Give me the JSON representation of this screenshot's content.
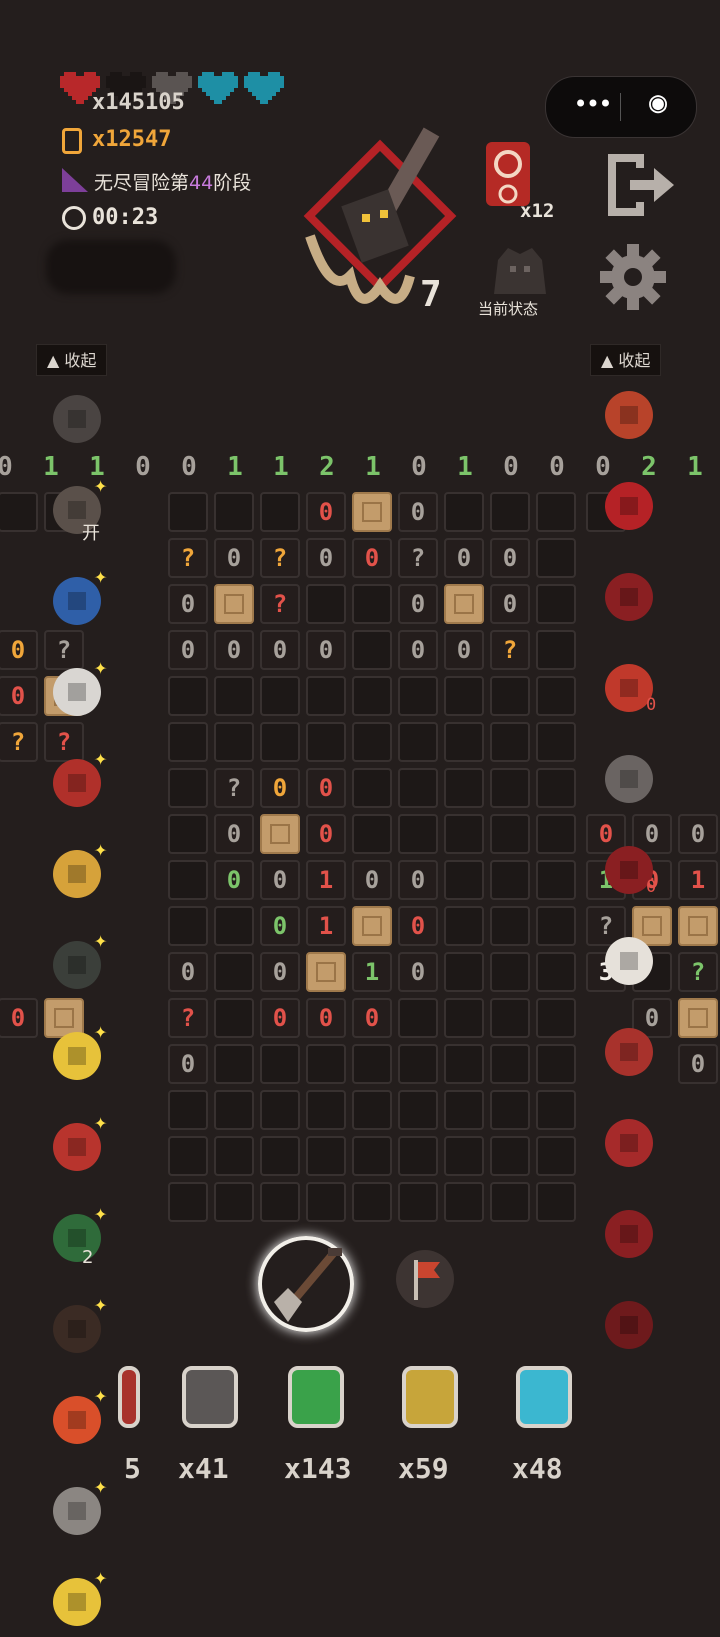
{
  "hud": {
    "hp_value": "x145105",
    "coin_value": "x12547",
    "stage_prefix": "无尽冒险第",
    "stage_number": "44",
    "stage_suffix": "阶段",
    "timer": "00:23"
  },
  "menu_capsule": {
    "more_glyph": "•••",
    "close_glyph": "◉"
  },
  "boss": {
    "level": "7"
  },
  "status": {
    "scroll_count": "x12",
    "current_status_label": "当前状态"
  },
  "panels": {
    "left_collapse": "▲ 收起",
    "right_collapse": "▲ 收起"
  },
  "column_hints": [
    "0",
    "1",
    "1",
    "0",
    "0",
    "1",
    "1",
    "2",
    "1",
    "0",
    "1",
    "0",
    "0",
    "0",
    "2",
    "1"
  ],
  "column_hint_colors": [
    "#a7a19b",
    "#7cc46a",
    "#7cc46a",
    "#a7a19b",
    "#a7a19b",
    "#7cc46a",
    "#7cc46a",
    "#7cc46a",
    "#7cc46a",
    "#a7a19b",
    "#7cc46a",
    "#a7a19b",
    "#a7a19b",
    "#a7a19b",
    "#7cc46a",
    "#7cc46a"
  ],
  "left_items": [
    {
      "icon": "dark-rock-icon"
    },
    {
      "icon": "pickaxe-icon",
      "sub": "开"
    },
    {
      "icon": "blue-chain-icon"
    },
    {
      "icon": "white-stone-icon"
    },
    {
      "icon": "red-explosion-icon"
    },
    {
      "icon": "gold-shield-icon"
    },
    {
      "icon": "hooded-figure-icon"
    },
    {
      "icon": "golden-idol-icon"
    },
    {
      "icon": "red-coin-icon"
    },
    {
      "icon": "green-turtle-shell-icon",
      "sub": "2"
    },
    {
      "icon": "cabinet-icon"
    },
    {
      "icon": "coin-pile-icon"
    },
    {
      "icon": "eye-icon"
    },
    {
      "icon": "gold-burst-icon"
    }
  ],
  "right_items": [
    {
      "icon": "flame-creature-icon"
    },
    {
      "icon": "red-ghost-icon"
    },
    {
      "icon": "red-swirl-icon"
    },
    {
      "icon": "dynamite-icon",
      "sub": "0"
    },
    {
      "icon": "crossed-pot-icon"
    },
    {
      "icon": "broken-heart-icon",
      "sub": "0"
    },
    {
      "icon": "three-claw-icon"
    },
    {
      "icon": "potion-jar-icon"
    },
    {
      "icon": "red-flower-icon"
    },
    {
      "icon": "anvil-icon"
    },
    {
      "icon": "crossed-eye-icon"
    }
  ],
  "tools": {
    "selected": "shovel-icon",
    "other": "flag-marker-icon"
  },
  "inventory": [
    {
      "icon": "partial-item-icon",
      "count": "5"
    },
    {
      "icon": "empty-bottle-icon",
      "count": "x41"
    },
    {
      "icon": "green-flag-icon",
      "count": "x143"
    },
    {
      "icon": "magnifier-icon",
      "count": "x59"
    },
    {
      "icon": "blue-heart-potion-icon",
      "count": "x48"
    }
  ],
  "grid": {
    "rows": [
      [
        ".",
        ".",
        ".",
        ".",
        ".",
        "r0",
        "C",
        "g0",
        ".",
        ".",
        ".",
        ".",
        "#",
        "#"
      ],
      [
        "#",
        "#",
        "o?",
        "g0",
        "o?",
        "g0",
        "r0",
        "g?",
        "g0",
        "g0",
        ".",
        "#",
        "#",
        "#"
      ],
      [
        "#",
        "#",
        "g0",
        "C",
        "r?",
        ".",
        ".",
        "g0",
        "C",
        "g0",
        ".",
        "#",
        "#",
        "#"
      ],
      [
        "o0",
        "g?",
        "g0",
        "g0",
        "g0",
        "g0",
        ".",
        "g0",
        "g0",
        "o?",
        ".",
        "#",
        "#",
        "#"
      ],
      [
        "r0",
        "C",
        ".",
        ".",
        ".",
        ".",
        ".",
        ".",
        ".",
        ".",
        ".",
        "#",
        "#",
        "#"
      ],
      [
        "o?",
        "r?",
        ".",
        ".",
        ".",
        ".",
        ".",
        ".",
        ".",
        ".",
        ".",
        "#",
        "#",
        "#"
      ],
      [
        "#",
        "#",
        ".",
        "g?",
        "o0",
        "r0",
        ".",
        ".",
        ".",
        ".",
        ".",
        "#",
        "#",
        "#"
      ],
      [
        "#",
        "#",
        ".",
        "g0",
        "C",
        "r0",
        ".",
        ".",
        ".",
        ".",
        ".",
        "r0",
        "g0",
        "g0"
      ],
      [
        "#",
        "#",
        ".",
        "G0",
        "g0",
        "r1",
        "g0",
        "g0",
        ".",
        ".",
        ".",
        "G1",
        "r0",
        "r1"
      ],
      [
        "#",
        "#",
        ".",
        ".",
        "G0",
        "r1",
        "C",
        "r0",
        ".",
        ".",
        ".",
        "g?",
        "C",
        "C"
      ],
      [
        "#",
        "#",
        "g0",
        ".",
        "g0",
        "C",
        "G1",
        "g0",
        ".",
        ".",
        ".",
        "w3",
        ".",
        "G?"
      ],
      [
        "r0",
        "C",
        "r?",
        ".",
        "r0",
        "r0",
        "r0",
        ".",
        ".",
        ".",
        ".",
        "#",
        "g0",
        "C"
      ],
      [
        "#",
        "#",
        "g0",
        ".",
        ".",
        ".",
        ".",
        ".",
        ".",
        ".",
        ".",
        "#",
        "#",
        "g0"
      ],
      [
        "#",
        "#",
        ".",
        ".",
        ".",
        ".",
        ".",
        ".",
        ".",
        ".",
        ".",
        "#",
        "#",
        "#"
      ],
      [
        "#",
        "#",
        ".",
        ".",
        ".",
        ".",
        ".",
        ".",
        ".",
        ".",
        ".",
        "#",
        "#",
        "#"
      ],
      [
        "#",
        "#",
        ".",
        ".",
        ".",
        ".",
        ".",
        ".",
        ".",
        ".",
        ".",
        "#",
        "#",
        "#"
      ]
    ]
  },
  "colors": {
    "background": "#241e1d",
    "coin_gold": "#f0a63a",
    "stage_highlight": "#c77bdc",
    "number_gray": "#a7a19b",
    "number_green": "#7cc46a",
    "number_red": "#e2524a",
    "number_orange": "#f0a63a",
    "heart_red": "#b8282a",
    "heart_cyan": "#1e8fa5"
  }
}
